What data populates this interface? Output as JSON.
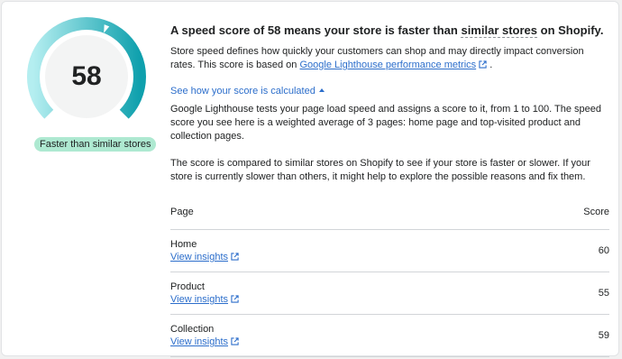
{
  "score": {
    "value": "58",
    "max": 100,
    "gauge_fill": 0.58,
    "colors": {
      "arc_start": "#a3e8ea",
      "arc_end": "#12a4b0",
      "track": "#e4e5e7"
    }
  },
  "badge": {
    "label": "Faster than similar stores",
    "color": "#aee9d1"
  },
  "heading": {
    "prefix": "A speed score of 58 means your store is faster than ",
    "emphasis": "similar stores",
    "suffix": " on Shopify."
  },
  "intro": {
    "text": "Store speed defines how quickly your customers can shop and may directly impact conversion rates. This score is based on ",
    "link": "Google Lighthouse performance metrics",
    "after": " ."
  },
  "toggle": {
    "label": "See how your score is calculated"
  },
  "explanation": {
    "p1": "Google Lighthouse tests your page load speed and assigns a score to it, from 1 to 100. The speed score you see here is a weighted average of 3 pages: home page and top-visited product and collection pages.",
    "p2": "The score is compared to similar stores on Shopify to see if your store is faster or slower. If your store is currently slower than others, it might help to explore the possible reasons and fix them."
  },
  "table": {
    "headers": {
      "page": "Page",
      "score": "Score"
    },
    "rows": [
      {
        "page": "Home",
        "link": "View insights",
        "score": "60"
      },
      {
        "page": "Product",
        "link": "View insights",
        "score": "55"
      },
      {
        "page": "Collection",
        "link": "View insights",
        "score": "59"
      }
    ]
  },
  "link_color": "#2c6ecb"
}
